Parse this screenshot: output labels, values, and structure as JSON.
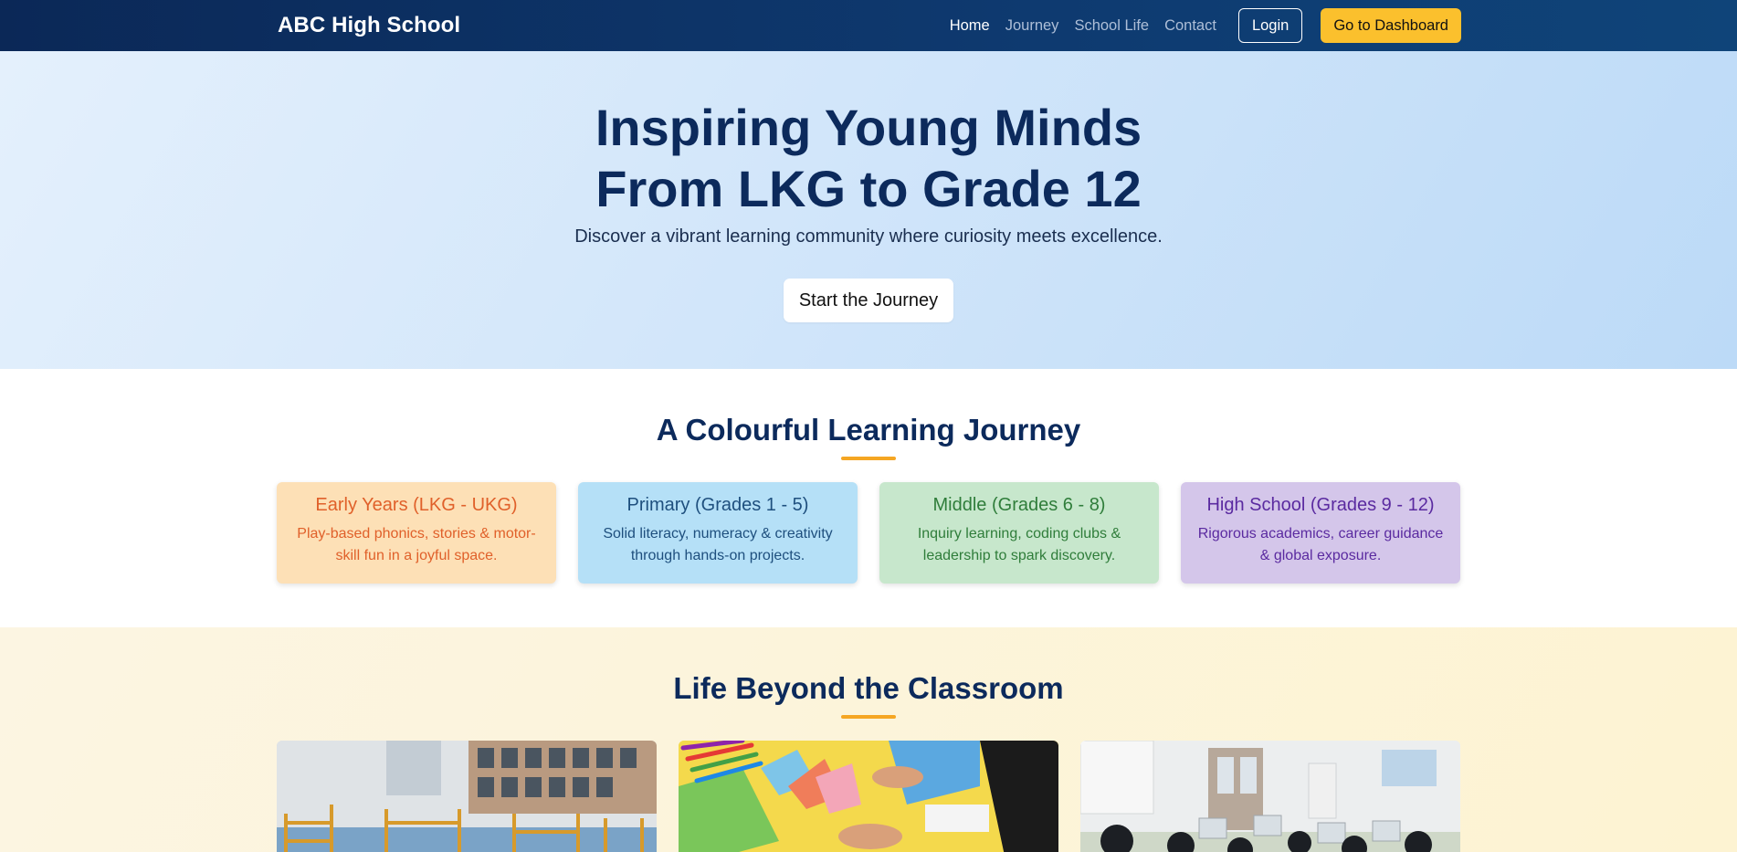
{
  "nav": {
    "brand": "ABC High School",
    "links": [
      {
        "label": "Home",
        "active": true
      },
      {
        "label": "Journey",
        "active": false
      },
      {
        "label": "School Life",
        "active": false
      },
      {
        "label": "Contact",
        "active": false
      }
    ],
    "login_label": "Login",
    "dashboard_label": "Go to Dashboard"
  },
  "hero": {
    "title_line1": "Inspiring Young Minds",
    "title_line2": "From LKG to Grade 12",
    "subtitle": "Discover a vibrant learning community where curiosity meets excellence.",
    "cta_label": "Start the Journey"
  },
  "journey": {
    "title": "A Colourful Learning Journey",
    "cards": [
      {
        "title": "Early Years (LKG - UKG)",
        "desc": "Play-based phonics, stories & motor-skill fun in a joyful space."
      },
      {
        "title": "Primary (Grades 1 - 5)",
        "desc": "Solid literacy, numeracy & creativity through hands-on projects."
      },
      {
        "title": "Middle (Grades 6 - 8)",
        "desc": "Inquiry learning, coding clubs & leadership to spark discovery."
      },
      {
        "title": "High School (Grades 9 - 12)",
        "desc": "Rigorous academics, career guidance & global exposure."
      }
    ]
  },
  "life": {
    "title": "Life Beyond the Classroom"
  },
  "colors": {
    "nav_bg": "#0b2857",
    "accent_yellow": "#fbc02d",
    "underline_orange": "#f5a623",
    "heading_navy": "#0c2a5c"
  }
}
